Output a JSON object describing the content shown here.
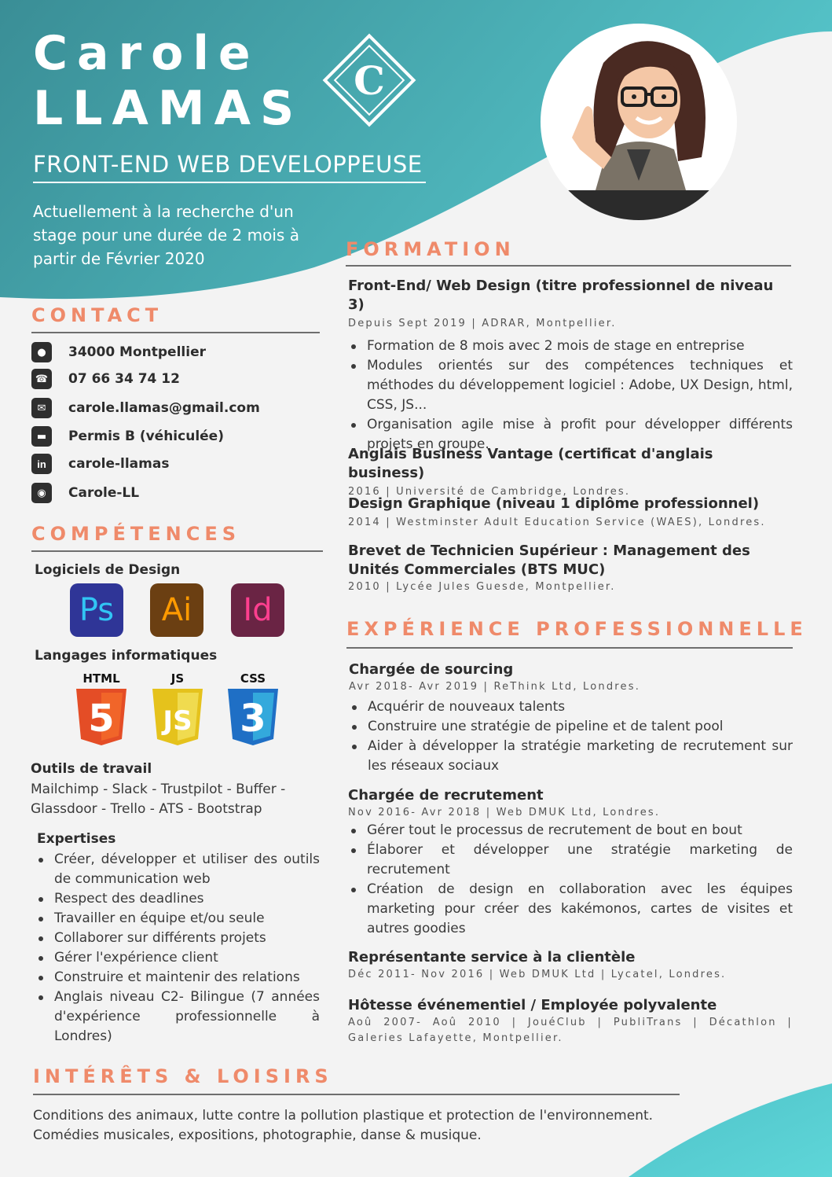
{
  "header": {
    "first_name": "Carole",
    "last_name": "LLAMAS",
    "logo_letter": "C",
    "job_title": "FRONT-END WEB DEVELOPPEUSE",
    "search_text": "Actuellement à la recherche d'un stage pour une durée de 2 mois à partir de Février 2020"
  },
  "colors": {
    "teal_dark": "#3a9199",
    "teal_light": "#52c9cf",
    "accent": "#ef8a6a",
    "background": "#f3f3f3"
  },
  "contact": {
    "heading": "CONTACT",
    "items": [
      {
        "icon": "location-pin-icon",
        "text": "34000 Montpellier"
      },
      {
        "icon": "phone-icon",
        "text": "07 66 34 74 12"
      },
      {
        "icon": "mail-icon",
        "text": "carole.llamas@gmail.com"
      },
      {
        "icon": "car-icon",
        "text": "Permis B (véhiculée)"
      },
      {
        "icon": "linkedin-icon",
        "text": "carole-llamas"
      },
      {
        "icon": "github-icon",
        "text": "Carole-LL"
      }
    ]
  },
  "competences": {
    "heading": "COMPÉTENCES",
    "design_heading": "Logiciels de Design",
    "design_tools": [
      {
        "label": "Ps",
        "bg": "#2f3597",
        "fg": "#31c5f4"
      },
      {
        "label": "Ai",
        "bg": "#6b3f12",
        "fg": "#ff9a00"
      },
      {
        "label": "Id",
        "bg": "#6a2444",
        "fg": "#ff3f8f"
      }
    ],
    "lang_heading": "Langages informatiques",
    "languages": [
      {
        "label": "HTML",
        "glyph": "5",
        "color": "#e44d26"
      },
      {
        "label": "JS",
        "glyph": "JS",
        "color": "#f0db4f"
      },
      {
        "label": "CSS",
        "glyph": "3",
        "color": "#1f6fc5"
      }
    ],
    "tools_heading": "Outils de travail",
    "tools_text": "Mailchimp - Slack - Trustpilot - Buffer - Glassdoor - Trello - ATS - Bootstrap",
    "expertise_heading": "Expertises",
    "expertises": [
      "Créer, développer et utiliser des outils de communication web",
      "Respect des deadlines",
      "Travailler en équipe et/ou seule",
      "Collaborer sur différents projets",
      "Gérer l'expérience client",
      "Construire et maintenir des relations",
      "Anglais niveau C2- Bilingue (7 années d'expérience professionnelle à Londres)"
    ]
  },
  "formation": {
    "heading": "FORMATION",
    "entries": [
      {
        "title": "Front-End/ Web Design (titre professionnel de niveau 3)",
        "meta": "Depuis Sept 2019 | ADRAR, Montpellier.",
        "bullets": [
          "Formation de 8 mois avec 2 mois de stage en entreprise",
          "Modules orientés sur des compétences techniques et méthodes du développement logiciel : Adobe, UX Design, html, CSS, JS...",
          "Organisation agile mise à profit pour développer différents projets en groupe."
        ]
      },
      {
        "title": "Anglais Business Vantage (certificat d'anglais business)",
        "meta": "2016 | Université de Cambridge, Londres.",
        "bullets": []
      },
      {
        "title": "Design Graphique (niveau 1 diplôme professionnel)",
        "meta": "2014 | Westminster Adult Education Service (WAES), Londres.",
        "bullets": []
      },
      {
        "title": "Brevet de Technicien Supérieur : Management des Unités Commerciales (BTS MUC)",
        "meta": "2010 | Lycée Jules Guesde, Montpellier.",
        "bullets": []
      }
    ]
  },
  "experience": {
    "heading": "EXPÉRIENCE PROFESSIONNELLE",
    "entries": [
      {
        "title": "Chargée de sourcing",
        "meta": "Avr 2018- Avr 2019 | ReThink Ltd, Londres.",
        "bullets": [
          "Acquérir de nouveaux talents",
          "Construire une stratégie de pipeline et de talent pool",
          "Aider à développer la stratégie marketing de recrutement sur les réseaux sociaux"
        ]
      },
      {
        "title": "Chargée de recrutement",
        "meta": "Nov 2016- Avr 2018 | Web DMUK Ltd, Londres.",
        "bullets": [
          "Gérer tout le processus de recrutement de bout en bout",
          "Élaborer et développer une stratégie marketing de recrutement",
          "Création de design en collaboration avec les équipes marketing pour créer des kakémonos, cartes de visites et autres goodies"
        ]
      },
      {
        "title": "Représentante service à la clientèle",
        "meta": "Déc 2011- Nov 2016 | Web DMUK Ltd | Lycatel, Londres.",
        "bullets": []
      },
      {
        "title": "Hôtesse événementiel / Employée polyvalente",
        "meta": "Aoû 2007- Aoû 2010 | JouéClub | PubliTrans | Décathlon | Galeries Lafayette, Montpellier.",
        "bullets": []
      }
    ]
  },
  "interests": {
    "heading": "INTÉRÊTS & LOISIRS",
    "line1": "Conditions des animaux, lutte contre la pollution plastique et protection de l'environnement.",
    "line2": "Comédies musicales, expositions, photographie, danse & musique."
  }
}
